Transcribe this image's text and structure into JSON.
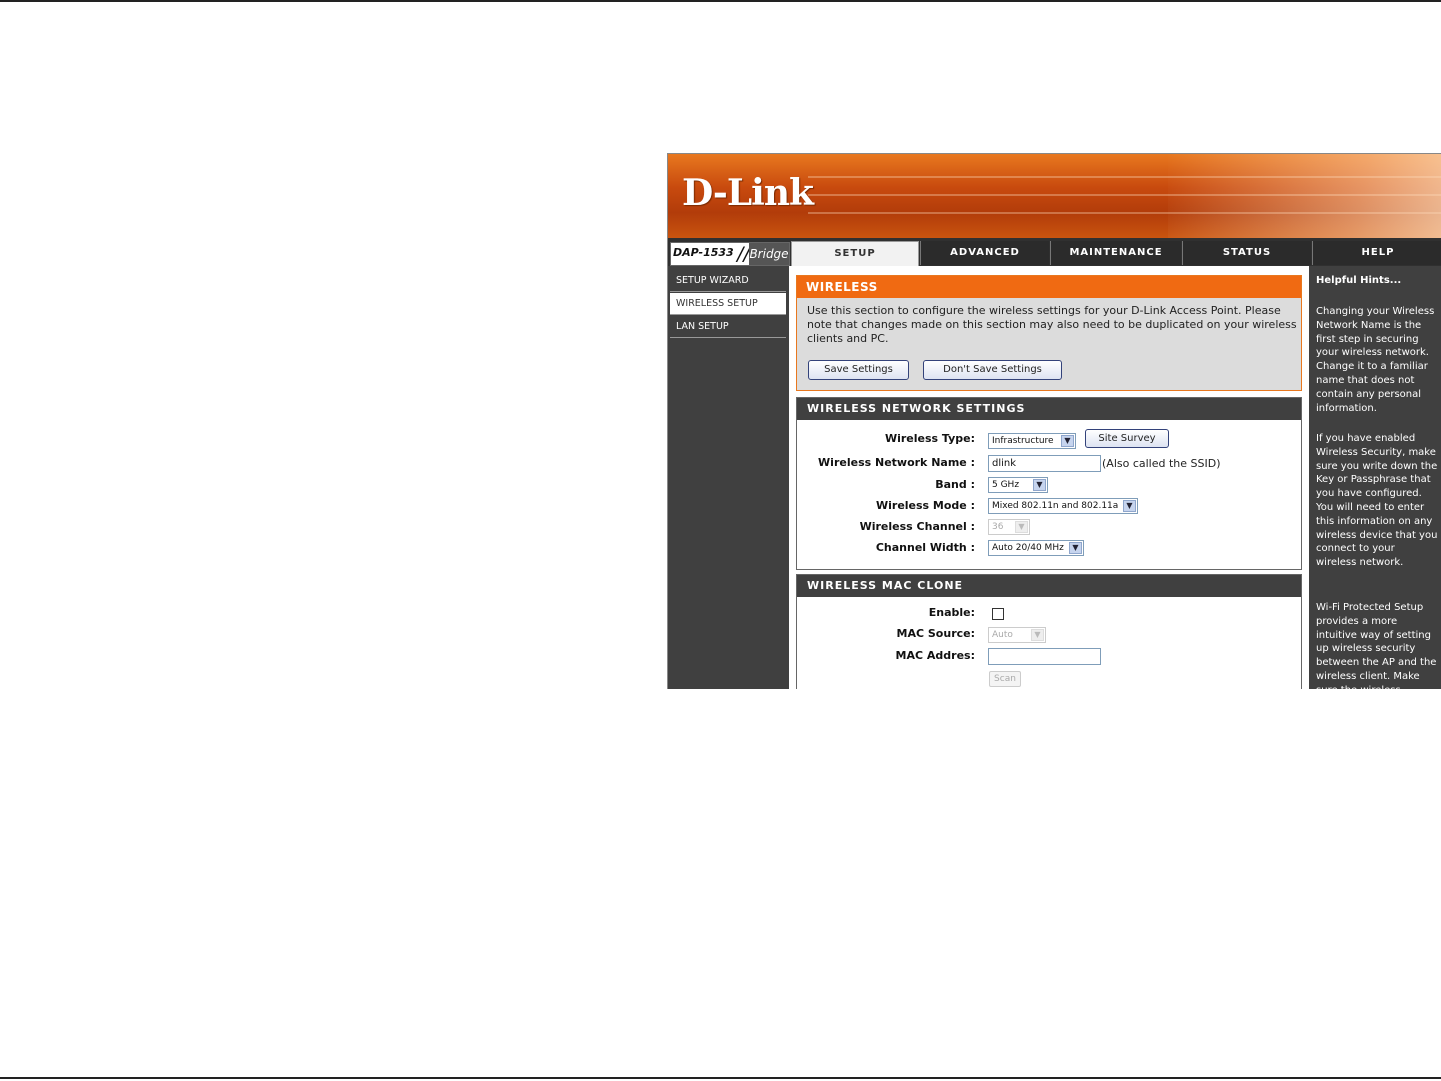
{
  "brand": {
    "logo_text": "D-Link",
    "model": "DAP-1533",
    "mode": "Bridge"
  },
  "nav": {
    "tabs": [
      {
        "label": "SETUP",
        "active": true
      },
      {
        "label": "ADVANCED",
        "active": false
      },
      {
        "label": "MAINTENANCE",
        "active": false
      },
      {
        "label": "STATUS",
        "active": false
      },
      {
        "label": "HELP",
        "active": false
      }
    ]
  },
  "sidebar": {
    "items": [
      {
        "label": "SETUP WIZARD",
        "active": false
      },
      {
        "label": "WIRELESS SETUP",
        "active": true
      },
      {
        "label": "LAN SETUP",
        "active": false
      }
    ]
  },
  "intro": {
    "title": "WIRELESS",
    "text": "Use this section to configure the wireless settings for your D-Link Access Point. Please note that changes made on this section may also need to be duplicated on your wireless clients and PC.",
    "save_label": "Save Settings",
    "dont_save_label": "Don't Save Settings"
  },
  "network_settings": {
    "title": "WIRELESS NETWORK SETTINGS",
    "type_label": "Wireless Type:",
    "type_value": "Infrastructure",
    "site_survey_label": "Site Survey",
    "name_label": "Wireless Network Name :",
    "name_value": "dlink",
    "name_note": "(Also called the SSID)",
    "band_label": "Band :",
    "band_value": "5 GHz",
    "mode_label": "Wireless Mode :",
    "mode_value": "Mixed 802.11n and 802.11a",
    "channel_label": "Wireless Channel :",
    "channel_value": "36",
    "width_label": "Channel Width :",
    "width_value": "Auto 20/40 MHz"
  },
  "mac_clone": {
    "title": "WIRELESS MAC CLONE",
    "enable_label": "Enable:",
    "enabled": false,
    "source_label": "MAC Source:",
    "source_value": "Auto",
    "address_label": "MAC Addres:",
    "address_value": "",
    "scan_label": "Scan"
  },
  "hints": {
    "title": "Helpful Hints...",
    "p1": "Changing your Wireless Network Name is the first step in securing your wireless network. Change it to a familiar name that does not contain any personal information.",
    "p2": "If you have enabled Wireless Security, make sure you write down the Key or Passphrase that you have configured. You will need to enter this information on any wireless device that you connect to your wireless network.",
    "p3": "Wi-Fi Protected Setup provides a more intuitive way of setting up wireless security between the AP and the wireless client. Make sure the wireless"
  },
  "colors": {
    "accent": "#f06a12",
    "dark": "#404040",
    "button_border": "#33427a"
  }
}
